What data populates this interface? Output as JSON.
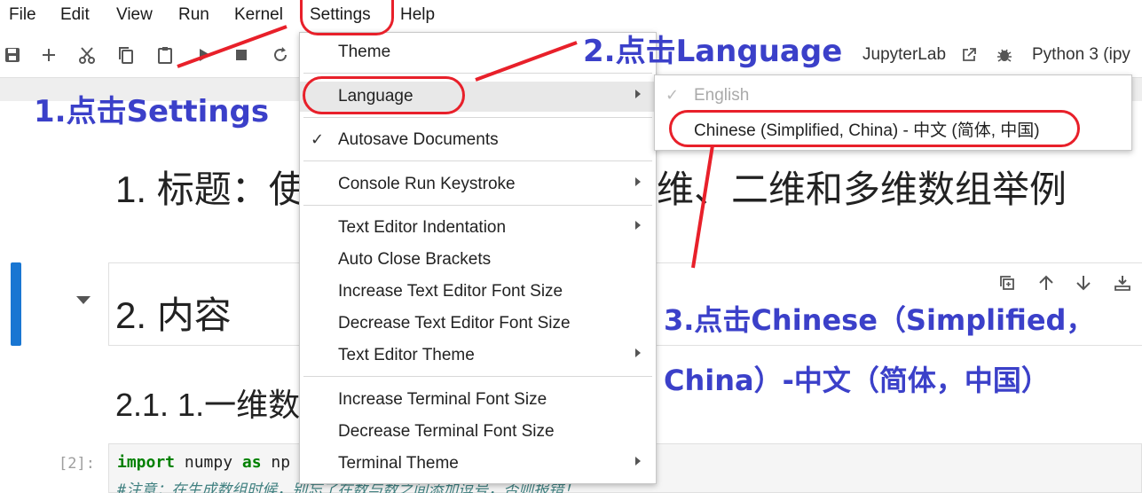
{
  "menubar": {
    "items": [
      "File",
      "Edit",
      "View",
      "Run",
      "Kernel",
      "Settings",
      "Help"
    ]
  },
  "toolbar": {
    "icons": [
      "save-icon",
      "add-cell-icon",
      "cut-icon",
      "copy-icon",
      "paste-icon",
      "run-icon",
      "stop-icon",
      "restart-icon"
    ],
    "jupyterlab_label": "JupyterLab",
    "kernel_label": "Python 3 (ipy"
  },
  "notebook": {
    "heading1_left": "1. 标题：使",
    "heading1_right": "维、二维和多维数组举例",
    "heading2": "2. 内容",
    "heading3": "2.1. 1.一维数",
    "cell_prompt": "[2]:",
    "code_import": "import",
    "code_module": " numpy ",
    "code_as": "as",
    "code_alias": " np",
    "code_comment": "#注意：在生成数组时候，别忘了在数与数之间添加逗号，否则报错！"
  },
  "settings_menu": {
    "items": [
      {
        "label": "Theme",
        "submenu": false,
        "checked": false
      },
      {
        "label": "Language",
        "submenu": true,
        "checked": false
      },
      {
        "label": "Autosave Documents",
        "submenu": false,
        "checked": true
      },
      {
        "label": "Console Run Keystroke",
        "submenu": true,
        "checked": false
      },
      {
        "label": "Text Editor Indentation",
        "submenu": true,
        "checked": false
      },
      {
        "label": "Auto Close Brackets",
        "submenu": false,
        "checked": false
      },
      {
        "label": "Increase Text Editor Font Size",
        "submenu": false,
        "checked": false
      },
      {
        "label": "Decrease Text Editor Font Size",
        "submenu": false,
        "checked": false
      },
      {
        "label": "Text Editor Theme",
        "submenu": true,
        "checked": false
      },
      {
        "label": "Increase Terminal Font Size",
        "submenu": false,
        "checked": false
      },
      {
        "label": "Decrease Terminal Font Size",
        "submenu": false,
        "checked": false
      },
      {
        "label": "Terminal Theme",
        "submenu": true,
        "checked": false
      }
    ]
  },
  "language_submenu": {
    "english": "English",
    "chinese": "Chinese (Simplified, China) - 中文 (简体, 中国)"
  },
  "annotations": {
    "step1": "1.点击Settings",
    "step2": "2.点击Language",
    "step3_line1": "3.点击Chinese（Simplified，",
    "step3_line2": "China）-中文（简体，中国）"
  },
  "colors": {
    "annotation_text": "#3b40c9",
    "annotation_oval": "#e8202a",
    "active_cell_bar": "#1976d2"
  }
}
